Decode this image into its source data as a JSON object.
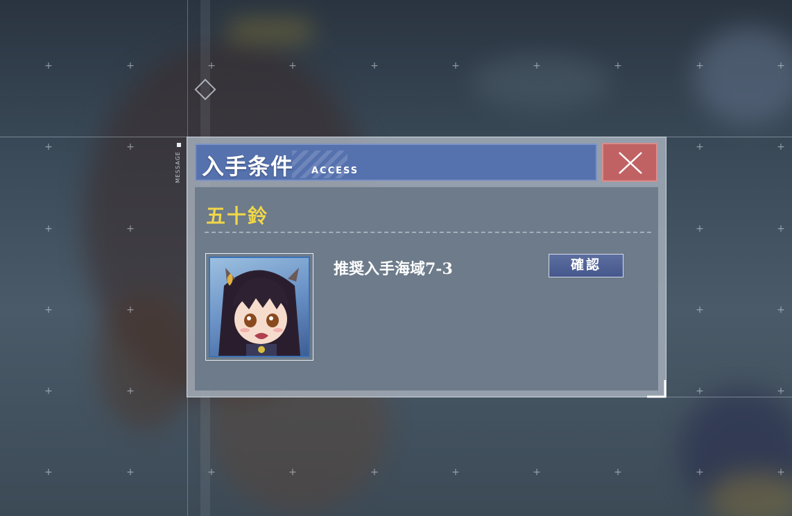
{
  "hud": {
    "message_label": "MESSAGE"
  },
  "dialog": {
    "title": "入手条件",
    "subtitle": "ACCESS",
    "close_icon": "close-x-icon",
    "character_name": "五十鈴",
    "entry": {
      "source": "推奨入手海域7-3",
      "confirm_label": "確認"
    }
  },
  "colors": {
    "title_bar": "#5571ae",
    "close_button": "#c06264",
    "name_text": "#f1d64a",
    "content_panel": "#6d7b8a"
  }
}
